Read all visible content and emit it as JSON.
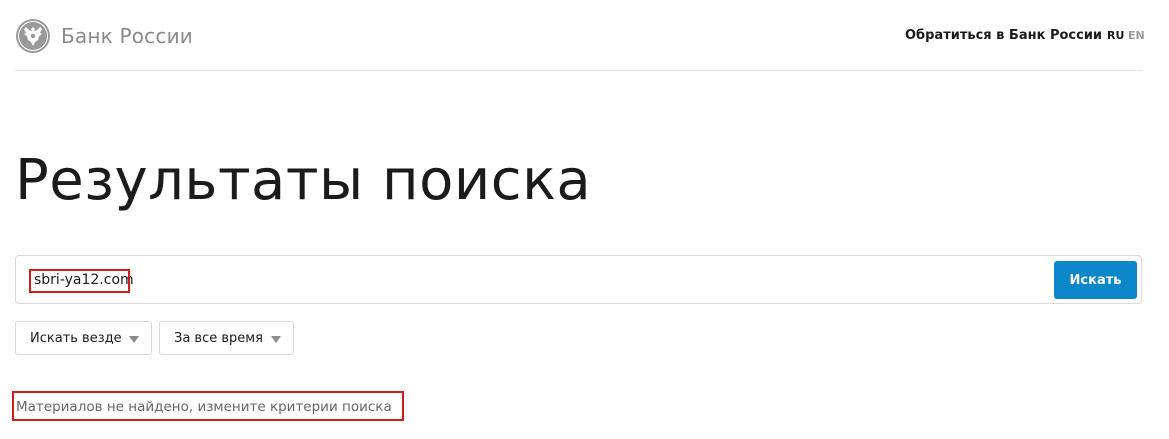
{
  "header": {
    "logo_text": "Банк России",
    "contact_link": "Обратиться в Банк России",
    "languages": [
      {
        "code": "RU",
        "active": true
      },
      {
        "code": "EN",
        "active": false
      }
    ]
  },
  "main": {
    "title": "Результаты поиска",
    "search": {
      "value": "sbri-ya12.com",
      "button_label": "Искать"
    },
    "filters": [
      {
        "selected": "Искать везде"
      },
      {
        "selected": "За все время"
      }
    ],
    "message": "Материалов не найдено, измените критерии поиска"
  },
  "colors": {
    "accent": "#0a86c9",
    "highlight": "#d41c1c",
    "muted_text": "#8a8a8a"
  },
  "icons": {
    "logo": "double-headed-eagle-icon",
    "filter_arrow": "chevron-down-icon"
  }
}
